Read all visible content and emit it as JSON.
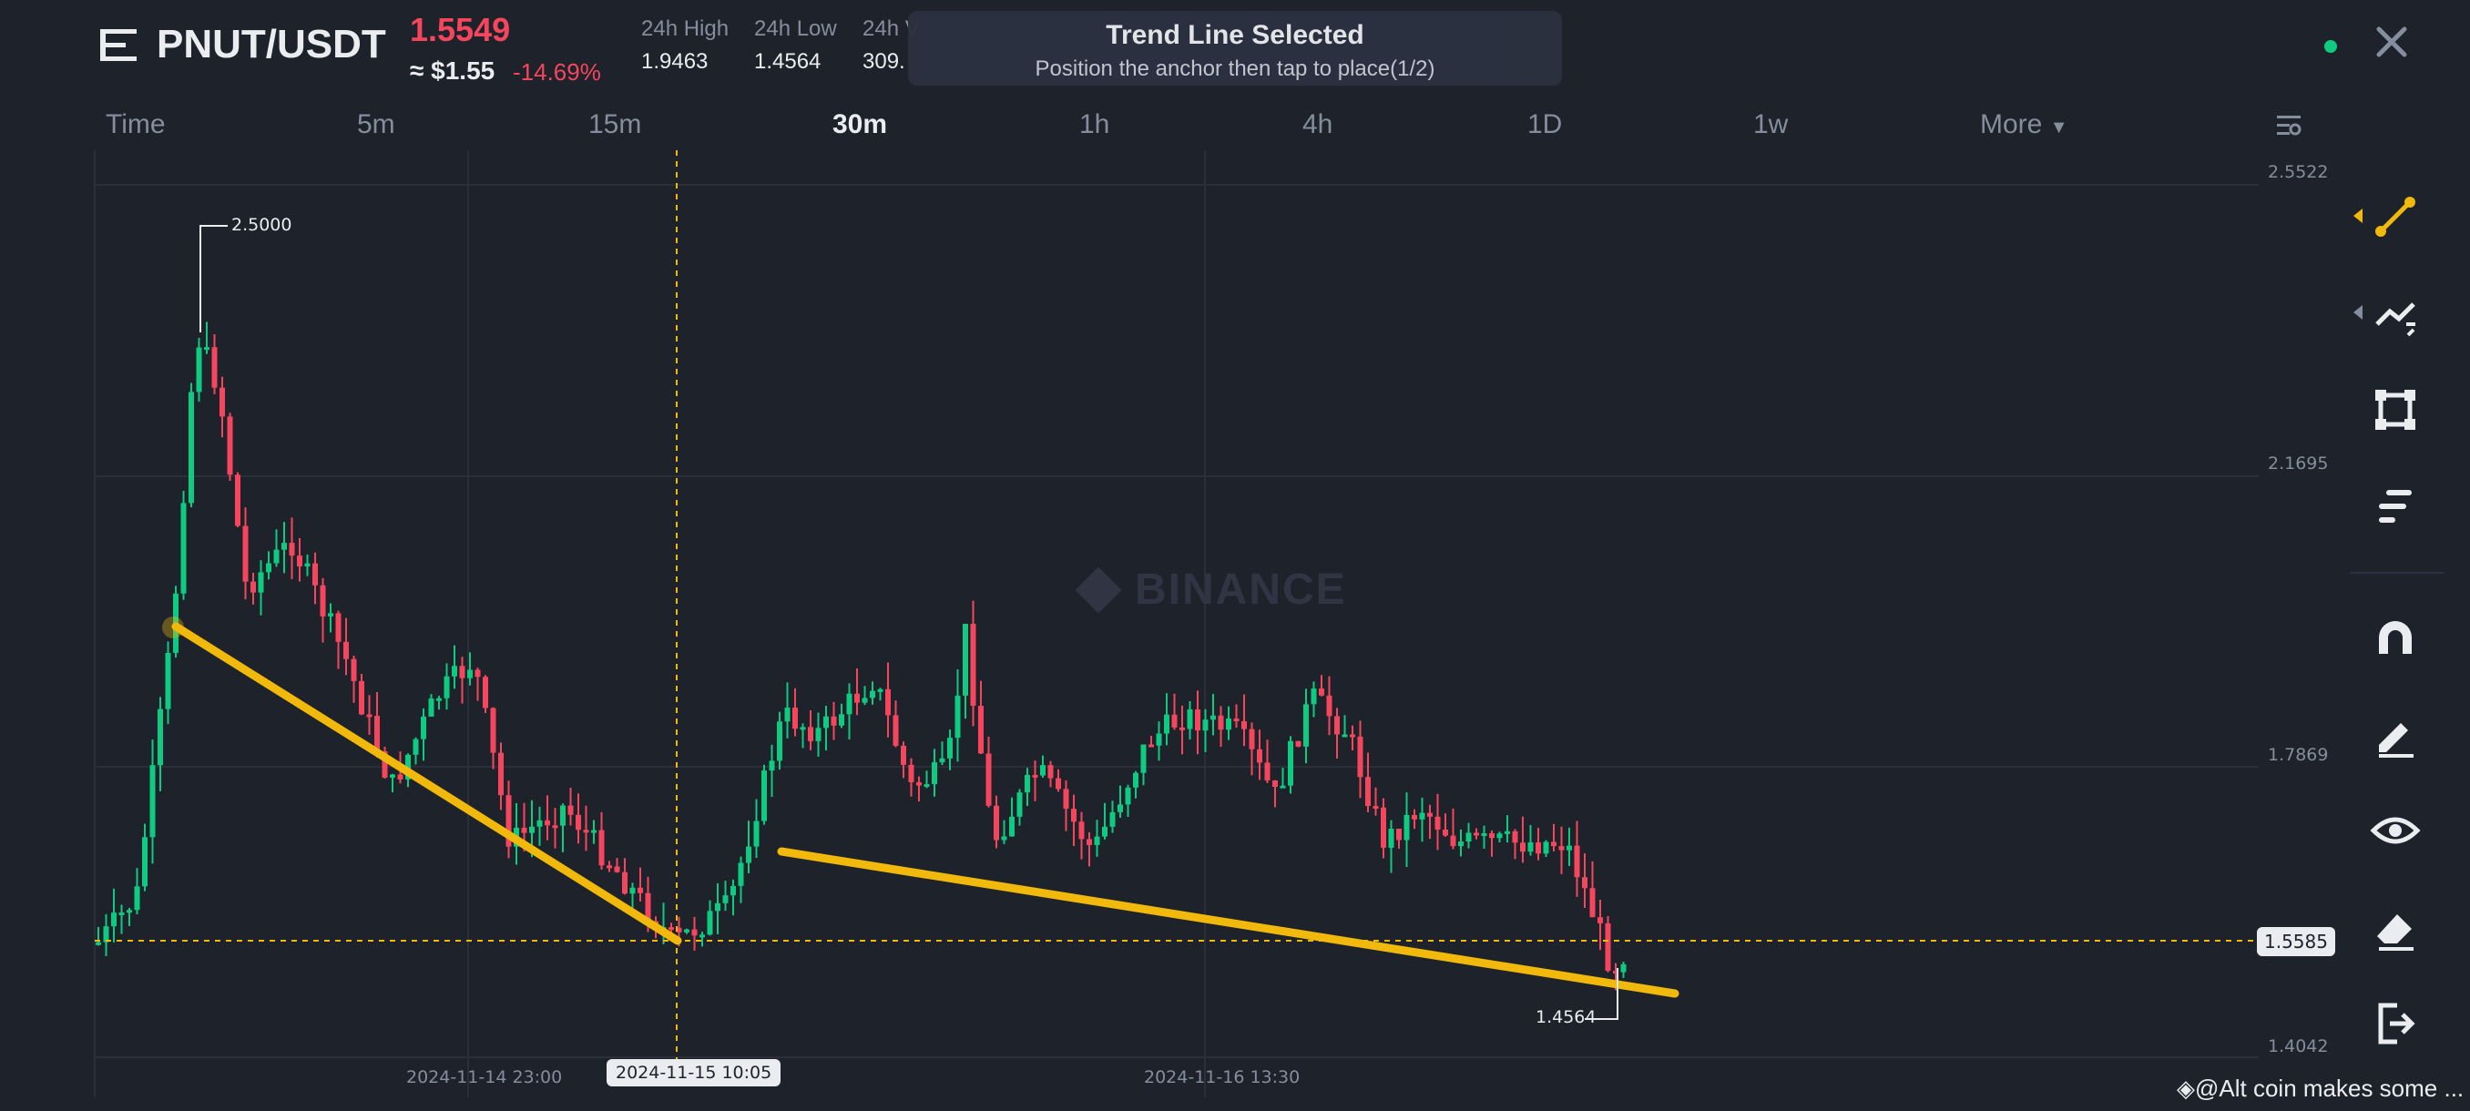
{
  "header": {
    "pair": "PNUT/USDT",
    "last_price": "1.5549",
    "usd_price": "≈ $1.55",
    "change_pct": "-14.69%",
    "stats": [
      {
        "label": "24h High",
        "value": "1.9463"
      },
      {
        "label": "24h Low",
        "value": "1.4564"
      },
      {
        "label": "24h V",
        "value": "309."
      }
    ]
  },
  "toast": {
    "title": "Trend Line Selected",
    "subtitle": "Position the anchor then tap to place(1/2)"
  },
  "tabs": [
    "Time",
    "5m",
    "15m",
    "30m",
    "1h",
    "4h",
    "1D",
    "1w",
    "More"
  ],
  "active_tab": "30m",
  "chart": {
    "y_labels": [
      "2.5522",
      "2.1695",
      "1.7869",
      "1.4042"
    ],
    "x_labels": [
      "2024-11-14 23:00",
      "2024-11-16 13:30"
    ],
    "crosshair_date": "2024-11-15 10:05",
    "last_price_tag": "1.5585",
    "high_annotation": "2.5000",
    "low_annotation": "1.4564",
    "watermark": "BINANCE",
    "colors": {
      "up": "#0ecb81",
      "down": "#f6465d",
      "trendline": "#f0b90b",
      "bg": "#1e222b"
    }
  },
  "toolbar": {
    "icons": [
      "trend-line-icon",
      "fib-icon",
      "rectangle-icon",
      "text-tools-icon",
      "magnet-icon",
      "pencil-icon",
      "eye-icon",
      "eraser-icon",
      "exit-icon"
    ]
  },
  "credit": "@Alt coin makes some ..."
}
